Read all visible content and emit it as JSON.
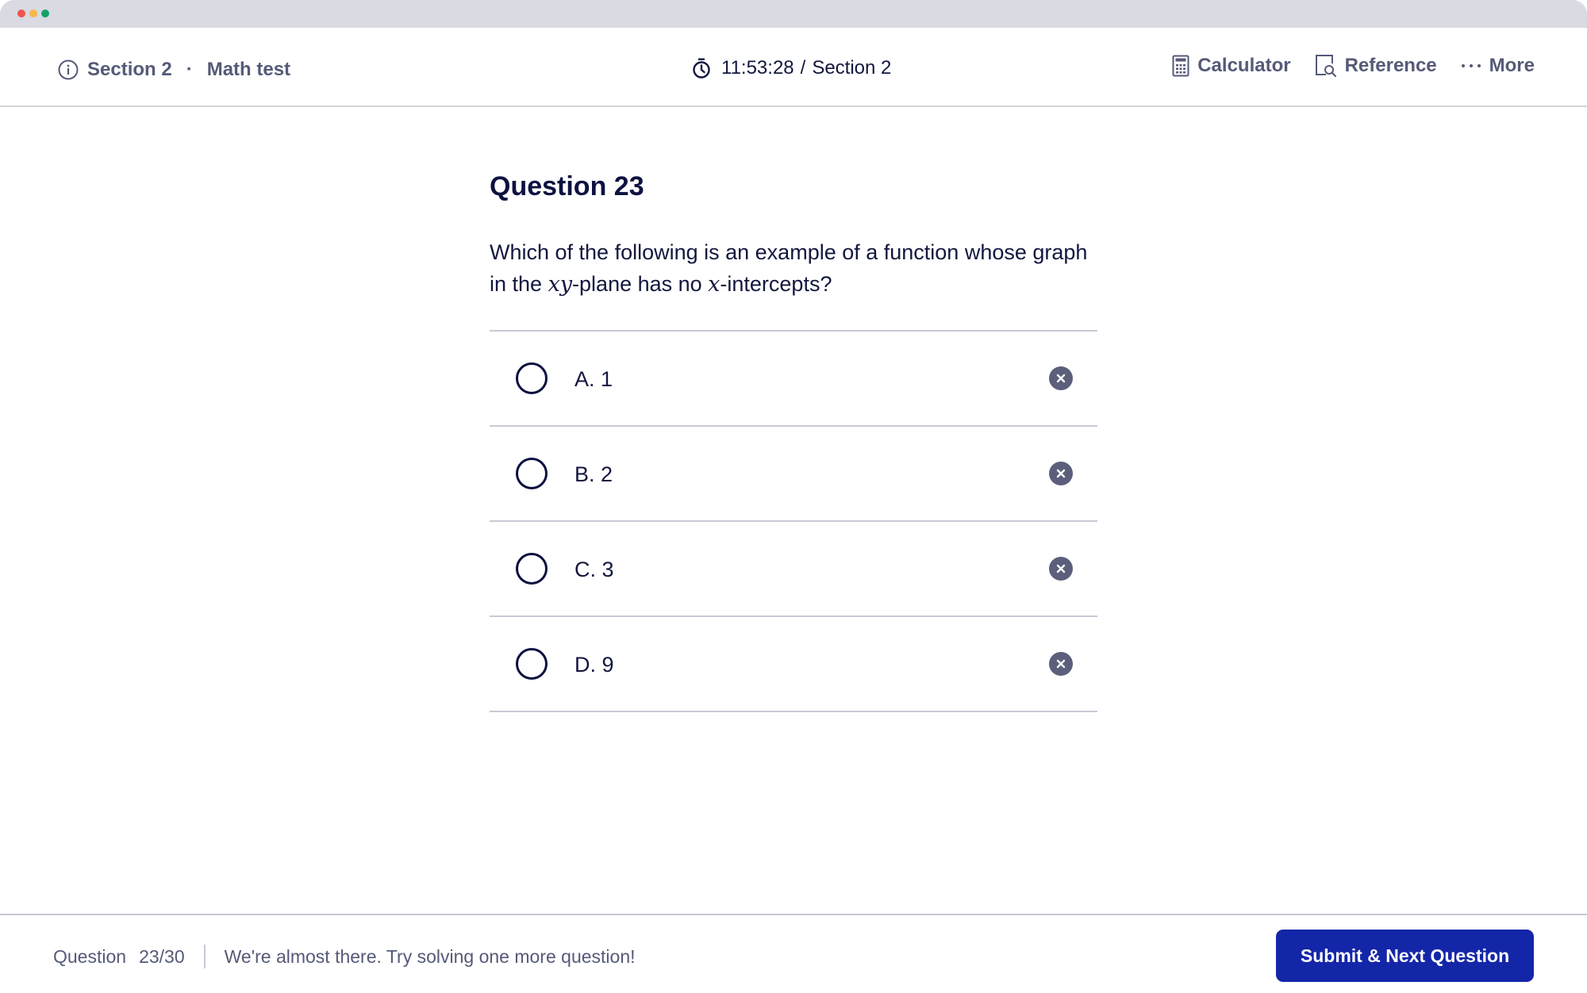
{
  "window": {
    "traffic_lights": [
      "close",
      "minimize",
      "maximize"
    ]
  },
  "header": {
    "section_label": "Section 2",
    "separator": "·",
    "test_name": "Math test",
    "timer": "11:53:28",
    "timer_separator": "/",
    "timer_section": "Section 2",
    "tools": [
      {
        "label": "Calculator",
        "icon": "calculator-icon"
      },
      {
        "label": "Reference",
        "icon": "reference-icon"
      },
      {
        "label": "More",
        "icon": "more-dots-icon"
      }
    ]
  },
  "question": {
    "title": "Question 23",
    "text_part1": "Which of the following is an example of a function whose graph in the ",
    "math1": "xy",
    "text_part2": "-plane has no ",
    "math2": "x",
    "text_part3": "-intercepts?",
    "options": [
      {
        "label": "A. 1",
        "selected": false
      },
      {
        "label": "B. 2",
        "selected": false
      },
      {
        "label": "C. 3",
        "selected": false
      },
      {
        "label": "D. 9",
        "selected": false
      }
    ]
  },
  "footer": {
    "question_label": "Question",
    "progress": "23/30",
    "message": "We're almost there. Try solving one more question!",
    "submit_label": "Submit & Next Question"
  },
  "colors": {
    "primary": "#1426A8",
    "text_dark": "#12173F",
    "text_muted": "#555A78",
    "divider": "#C7C9D6"
  }
}
